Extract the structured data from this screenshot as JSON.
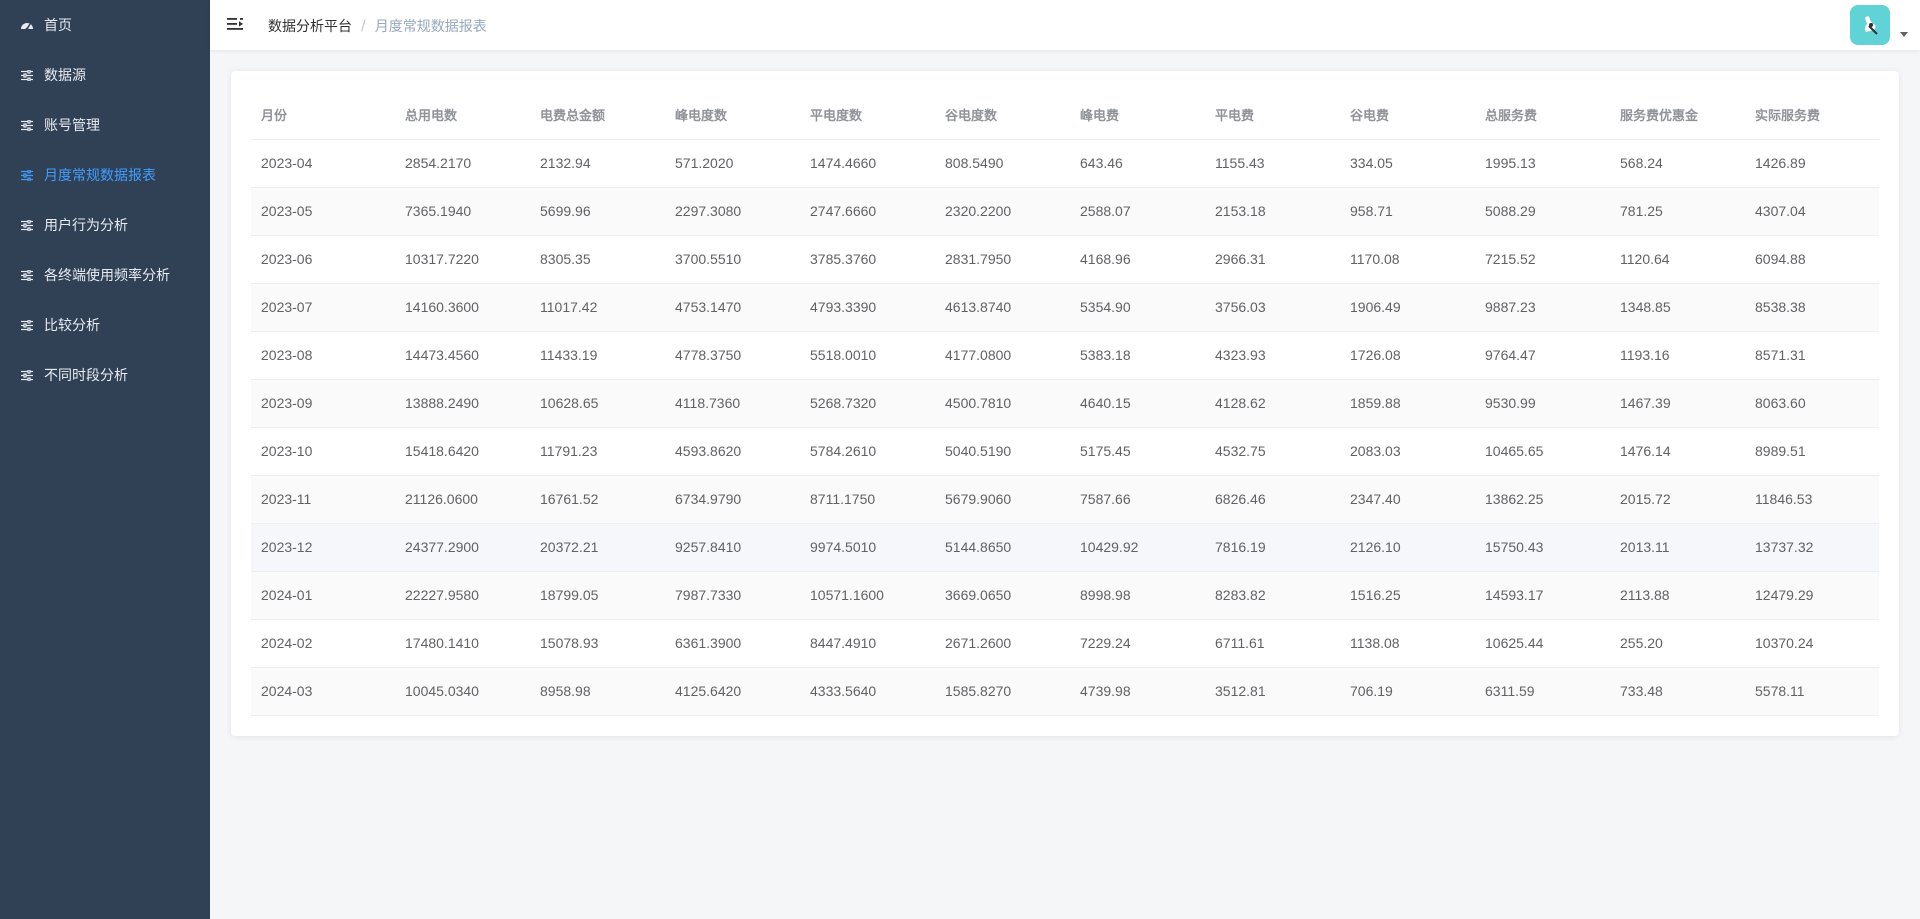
{
  "sidebar": {
    "items": [
      {
        "label": "首页",
        "icon": "dashboard-icon",
        "active": false
      },
      {
        "label": "数据源",
        "icon": "sliders-icon",
        "active": false
      },
      {
        "label": "账号管理",
        "icon": "sliders-icon",
        "active": false
      },
      {
        "label": "月度常规数据报表",
        "icon": "sliders-icon",
        "active": true
      },
      {
        "label": "用户行为分析",
        "icon": "sliders-icon",
        "active": false
      },
      {
        "label": "各终端使用频率分析",
        "icon": "sliders-icon",
        "active": false
      },
      {
        "label": "比较分析",
        "icon": "sliders-icon",
        "active": false
      },
      {
        "label": "不同时段分析",
        "icon": "sliders-icon",
        "active": false
      }
    ]
  },
  "header": {
    "breadcrumb": {
      "root": "数据分析平台",
      "separator": "/",
      "current": "月度常规数据报表"
    }
  },
  "colors": {
    "sidebar_bg": "#304156",
    "active": "#409eff",
    "avatar_bg": "#5fd3d6"
  },
  "table": {
    "columns": [
      "月份",
      "总用电数",
      "电费总金额",
      "峰电度数",
      "平电度数",
      "谷电度数",
      "峰电费",
      "平电费",
      "谷电费",
      "总服务费",
      "服务费优惠金",
      "实际服务费"
    ],
    "rows": [
      [
        "2023-04",
        "2854.2170",
        "2132.94",
        "571.2020",
        "1474.4660",
        "808.5490",
        "643.46",
        "1155.43",
        "334.05",
        "1995.13",
        "568.24",
        "1426.89"
      ],
      [
        "2023-05",
        "7365.1940",
        "5699.96",
        "2297.3080",
        "2747.6660",
        "2320.2200",
        "2588.07",
        "2153.18",
        "958.71",
        "5088.29",
        "781.25",
        "4307.04"
      ],
      [
        "2023-06",
        "10317.7220",
        "8305.35",
        "3700.5510",
        "3785.3760",
        "2831.7950",
        "4168.96",
        "2966.31",
        "1170.08",
        "7215.52",
        "1120.64",
        "6094.88"
      ],
      [
        "2023-07",
        "14160.3600",
        "11017.42",
        "4753.1470",
        "4793.3390",
        "4613.8740",
        "5354.90",
        "3756.03",
        "1906.49",
        "9887.23",
        "1348.85",
        "8538.38"
      ],
      [
        "2023-08",
        "14473.4560",
        "11433.19",
        "4778.3750",
        "5518.0010",
        "4177.0800",
        "5383.18",
        "4323.93",
        "1726.08",
        "9764.47",
        "1193.16",
        "8571.31"
      ],
      [
        "2023-09",
        "13888.2490",
        "10628.65",
        "4118.7360",
        "5268.7320",
        "4500.7810",
        "4640.15",
        "4128.62",
        "1859.88",
        "9530.99",
        "1467.39",
        "8063.60"
      ],
      [
        "2023-10",
        "15418.6420",
        "11791.23",
        "4593.8620",
        "5784.2610",
        "5040.5190",
        "5175.45",
        "4532.75",
        "2083.03",
        "10465.65",
        "1476.14",
        "8989.51"
      ],
      [
        "2023-11",
        "21126.0600",
        "16761.52",
        "6734.9790",
        "8711.1750",
        "5679.9060",
        "7587.66",
        "6826.46",
        "2347.40",
        "13862.25",
        "2015.72",
        "11846.53"
      ],
      [
        "2023-12",
        "24377.2900",
        "20372.21",
        "9257.8410",
        "9974.5010",
        "5144.8650",
        "10429.92",
        "7816.19",
        "2126.10",
        "15750.43",
        "2013.11",
        "13737.32"
      ],
      [
        "2024-01",
        "22227.9580",
        "18799.05",
        "7987.7330",
        "10571.1600",
        "3669.0650",
        "8998.98",
        "8283.82",
        "1516.25",
        "14593.17",
        "2113.88",
        "12479.29"
      ],
      [
        "2024-02",
        "17480.1410",
        "15078.93",
        "6361.3900",
        "8447.4910",
        "2671.2600",
        "7229.24",
        "6711.61",
        "1138.08",
        "10625.44",
        "255.20",
        "10370.24"
      ],
      [
        "2024-03",
        "10045.0340",
        "8958.98",
        "4125.6420",
        "4333.5640",
        "1585.8270",
        "4739.98",
        "3512.81",
        "706.19",
        "6311.59",
        "733.48",
        "5578.11"
      ]
    ]
  }
}
